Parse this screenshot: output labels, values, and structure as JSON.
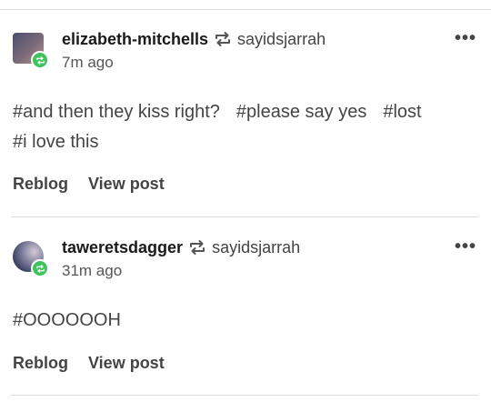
{
  "posts": [
    {
      "username": "elizabeth-mitchells",
      "source": "sayidsjarrah",
      "time": "7m ago",
      "tags": [
        "#and then they kiss right?",
        "#please say yes",
        "#lost",
        "#i love this"
      ],
      "reblog_label": "Reblog",
      "view_label": "View post"
    },
    {
      "username": "taweretsdagger",
      "source": "sayidsjarrah",
      "time": "31m ago",
      "tags": [
        "#OOOOOOH"
      ],
      "reblog_label": "Reblog",
      "view_label": "View post"
    }
  ],
  "more_label": "•••",
  "icons": {
    "reblog": "reblog-icon",
    "more": "more-options-icon",
    "badge": "reblog-badge-icon"
  },
  "colors": {
    "badge": "#3ec35d",
    "divider": "#dcdcdc"
  }
}
